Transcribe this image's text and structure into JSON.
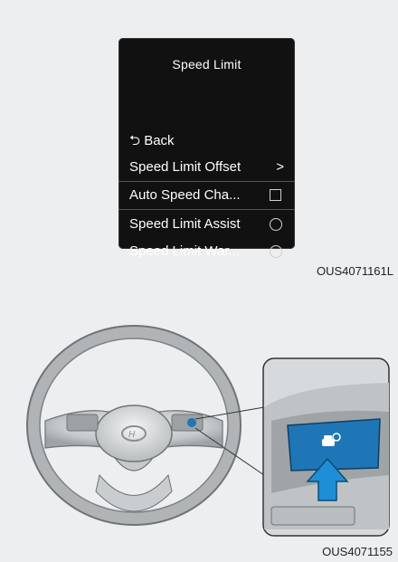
{
  "menu": {
    "title": "Speed Limit",
    "back": {
      "icon": "back-arrow-icon",
      "label": "Back"
    },
    "items": [
      {
        "label": "Speed Limit Offset",
        "control": "chevron-right-icon",
        "glyph": ">"
      },
      {
        "label": "Auto Speed Cha...",
        "control": "checkbox",
        "checked": false,
        "highlighted": true
      },
      {
        "label": "Speed Limit Assist",
        "control": "radio",
        "selected": false
      },
      {
        "label": "Speed Limit War...",
        "control": "radio",
        "selected": false
      }
    ]
  },
  "figures": {
    "top_code": "OUS4071161L",
    "bottom_code": "OUS4071155"
  },
  "colors": {
    "screen_bg": "#111111",
    "button_blue": "#1f76b6",
    "arrow_blue": "#1e8fd6",
    "page_bg": "#eceeef"
  }
}
